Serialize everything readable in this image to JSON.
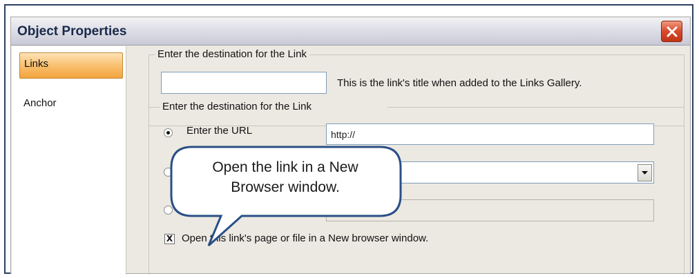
{
  "dialog": {
    "title": "Object Properties",
    "close_icon": "close-icon"
  },
  "nav": {
    "items": [
      {
        "label": "Links",
        "selected": true
      },
      {
        "label": "Anchor",
        "selected": false
      }
    ]
  },
  "title_group": {
    "label": "Enter the destination for the Link",
    "value": "",
    "helper": "This is the link's title when added to the Links Gallery."
  },
  "dest_group": {
    "label": "Enter the destination for the Link",
    "options": [
      {
        "label": "Enter the URL",
        "checked": true
      },
      {
        "label": "",
        "checked": false
      },
      {
        "label": "",
        "checked": false
      }
    ],
    "url_value": "http://",
    "select_value": "",
    "third_value": ""
  },
  "new_window": {
    "checked": true,
    "mark": "X",
    "label": "Open this link's page or file in a New browser window."
  },
  "callout": {
    "line1": "Open the link in a New",
    "line2": "Browser window."
  },
  "colors": {
    "selected_tab": "#f9c070",
    "close_button": "#d8492a",
    "callout_fill": "#ffffff",
    "callout_border": "#2a4f86"
  }
}
